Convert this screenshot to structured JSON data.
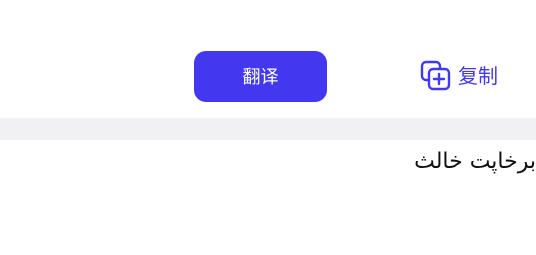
{
  "toolbar": {
    "translate_label": "翻译",
    "copy_label": "复制",
    "copy_icon": "copy-add-icon"
  },
  "output": {
    "text": "برخاپت خالث"
  },
  "colors": {
    "accent": "#4338f0",
    "band": "#f1f1f4",
    "text": "#111111"
  }
}
